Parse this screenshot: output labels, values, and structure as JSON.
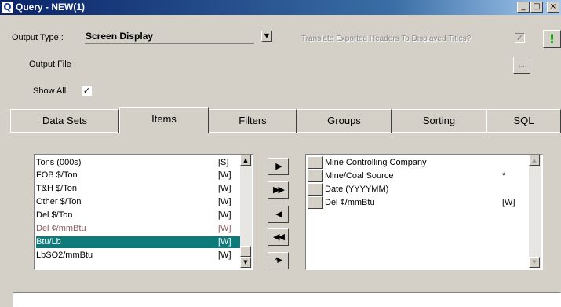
{
  "window": {
    "title": "Query - NEW(1)",
    "app_icon": "Q",
    "controls": {
      "minimize": "_",
      "maximize": "□",
      "close": "×"
    }
  },
  "form": {
    "output_type_label": "Output Type :",
    "output_type_value": "Screen Display",
    "translate_label": "Translate Exported Headers To Displayed Titles?",
    "translate_checked": "✓",
    "run_icon": "!",
    "output_file_label": "Output File :",
    "browse_label": "...",
    "show_all_label": "Show All",
    "show_all_checked": "✓"
  },
  "tabs": [
    {
      "label": "Data Sets"
    },
    {
      "label": "Items"
    },
    {
      "label": "Filters"
    },
    {
      "label": "Groups"
    },
    {
      "label": "Sorting"
    },
    {
      "label": "SQL"
    }
  ],
  "active_tab": "Items",
  "available_items": [
    {
      "name": "Tons (000s)",
      "tag": "[S]"
    },
    {
      "name": "FOB $/Ton",
      "tag": "[W]"
    },
    {
      "name": "T&H $/Ton",
      "tag": "[W]"
    },
    {
      "name": "Other $/Ton",
      "tag": "[W]"
    },
    {
      "name": "Del $/Ton",
      "tag": "[W]"
    },
    {
      "name": "Del ¢/mmBtu",
      "tag": "[W]"
    },
    {
      "name": "Btu/Lb",
      "tag": "[W]"
    },
    {
      "name": "LbSO2/mmBtu",
      "tag": "[W]"
    }
  ],
  "selected_item": "Btu/Lb",
  "move_buttons": {
    "add": "▶",
    "add_all": "▶▶",
    "remove": "◀",
    "remove_all": "◀◀",
    "special": "*▶"
  },
  "selected_items": [
    {
      "name": "Mine Controlling Company",
      "tag": ""
    },
    {
      "name": "Mine/Coal Source",
      "tag": "*"
    },
    {
      "name": "Date (YYYYMM)",
      "tag": ""
    },
    {
      "name": "Del ¢/mmBtu",
      "tag": "[W]"
    }
  ],
  "scroll": {
    "up": "▲",
    "down": "▼"
  }
}
